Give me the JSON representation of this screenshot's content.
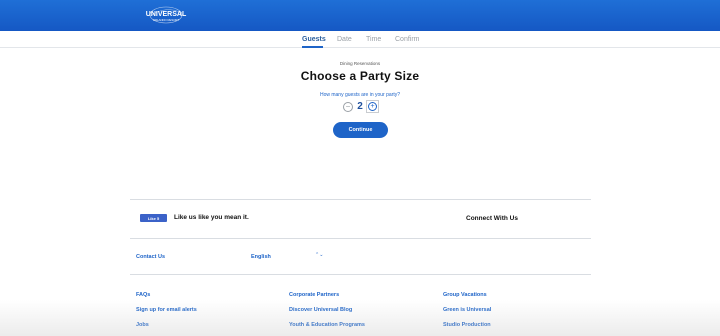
{
  "header": {
    "logo_text": "UNIVERSAL",
    "logo_subtext": "ORLANDO RESORT",
    "brand_color": "#1e64c8"
  },
  "steps": [
    {
      "label": "Guests",
      "active": true
    },
    {
      "label": "Date",
      "active": false
    },
    {
      "label": "Time",
      "active": false
    },
    {
      "label": "Confirm",
      "active": false
    }
  ],
  "main": {
    "eyebrow": "Dining Reservations",
    "title": "Choose a Party Size",
    "question": "How many guests are in your party?",
    "party_size": "2",
    "minus_symbol": "−",
    "plus_symbol": "+",
    "continue_label": "Continue"
  },
  "footer": {
    "facebook_label": "Like 5",
    "like_text": "Like us like you mean it.",
    "connect_text": "Connect With Us",
    "contact_label": "Contact Us",
    "language_value": "English",
    "language_arrows": "⌃⌄",
    "links_col1": [
      "FAQs",
      "Sign up for email alerts",
      "Jobs"
    ],
    "links_col2": [
      "Corporate Partners",
      "Discover Universal Blog",
      "Youth & Education Programs"
    ],
    "links_col3": [
      "Group Vacations",
      "Green is Universal",
      "Studio Production"
    ]
  }
}
